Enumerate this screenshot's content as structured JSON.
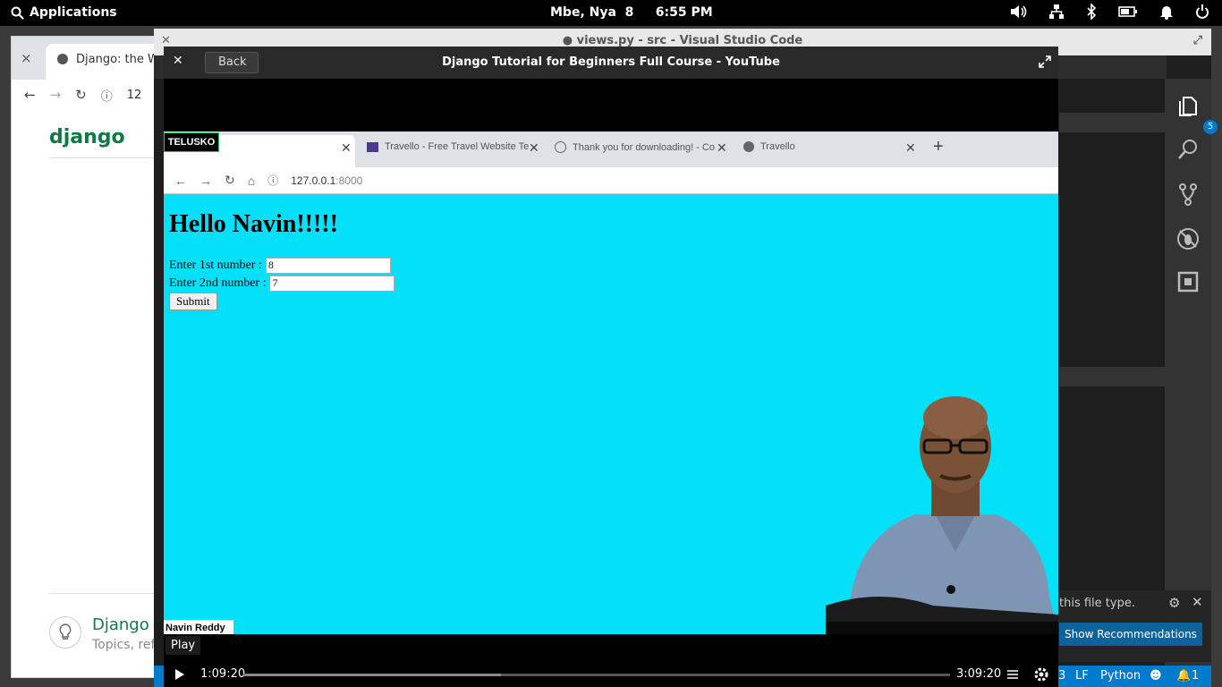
{
  "panel": {
    "applications": "Applications",
    "clock": "Mbe, Nya  8     6:55 PM"
  },
  "chrome": {
    "tab_close": "×",
    "tab_title": "Django: the We",
    "address": "12",
    "brand": "django",
    "topics_title": "Django",
    "topics_sub": "Topics, ref"
  },
  "vscode": {
    "title": "● views.py - src - Visual Studio Code",
    "badge": "5",
    "notif_text": "this file type.",
    "show_recommendations": "Show Recommendations",
    "status": {
      "eol": "LF",
      "language": "Python",
      "bell_count": "1"
    }
  },
  "video": {
    "title": "Django Tutorial for Beginners  Full Course - YouTube",
    "back_label": "Back",
    "telusko": "TELUSKO",
    "presenter": "Navin Reddy",
    "tooltip": "Play",
    "current_time": "1:09:20",
    "total_time": "3:09:20",
    "progress": 0.365,
    "inner_browser": {
      "tabs": [
        "Travello - Free Travel Website Te",
        "Thank you for downloading! - Co",
        "Travello"
      ],
      "address_host": "127.0.0.1",
      "address_port": ":8000",
      "heading": "Hello Navin!!!!!",
      "label1": "Enter 1st number :",
      "value1": "8",
      "label2": "Enter 2nd number :",
      "value2": "7",
      "submit": "Submit"
    }
  },
  "colors": {
    "page_bg": "#04e0f8",
    "vscode_status": "#007acc",
    "django_green": "#0c7a43"
  }
}
